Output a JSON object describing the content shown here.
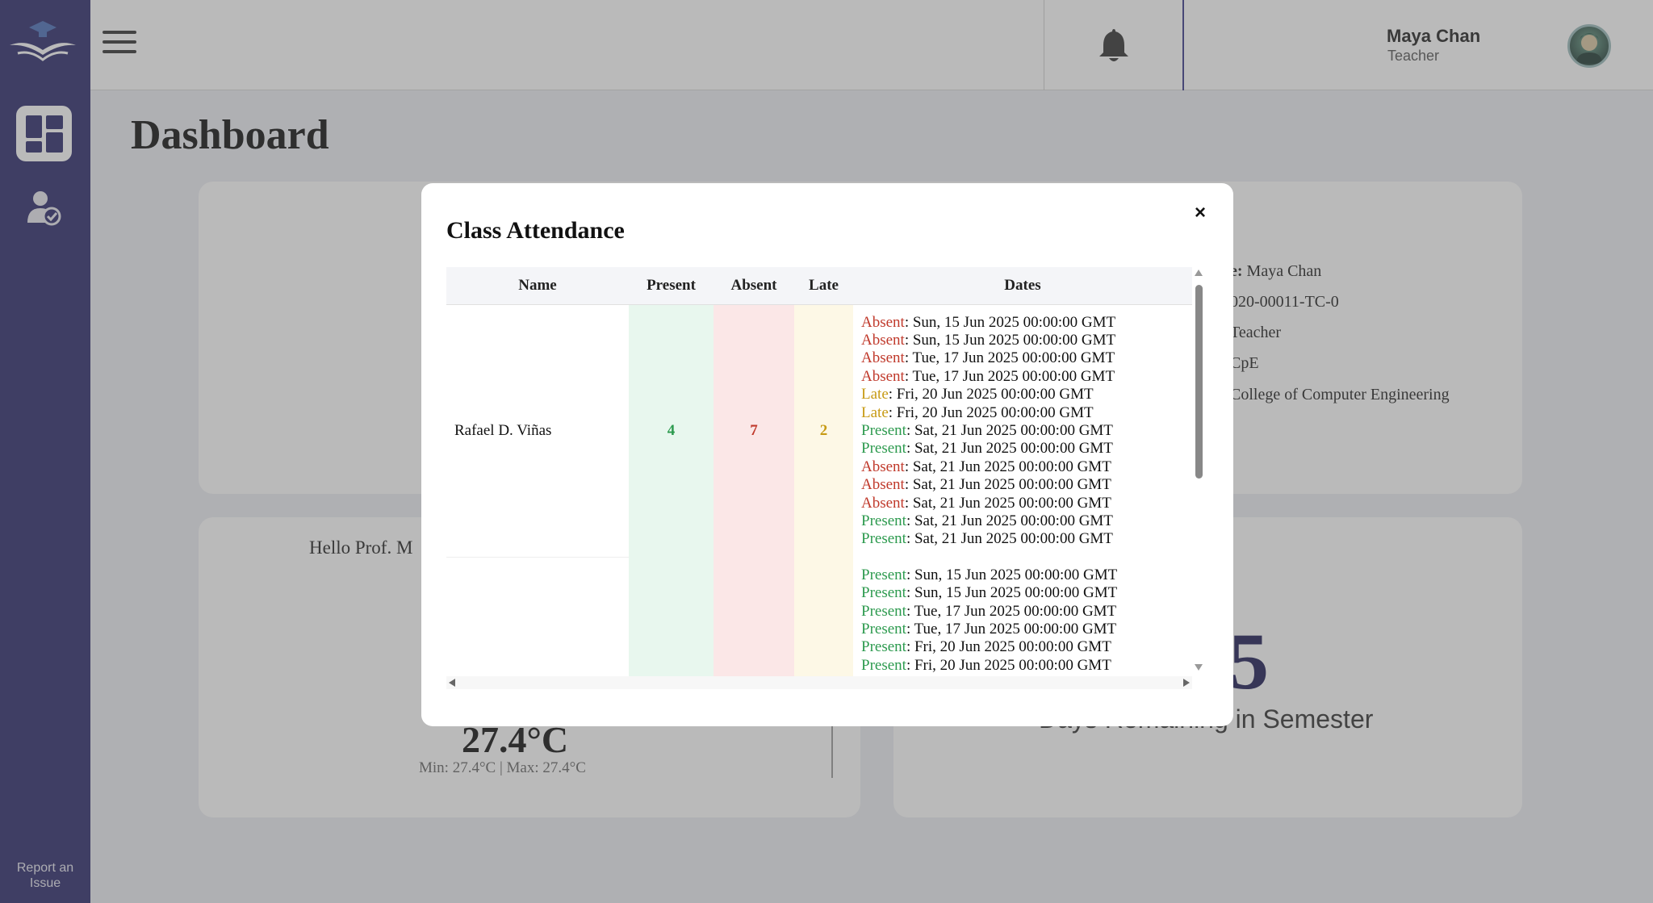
{
  "sidebar": {
    "report_label": "Report an Issue",
    "nav_icons": [
      "dashboard-icon",
      "attendance-icon"
    ],
    "colors": {
      "background": "#2b2a6b",
      "active": "#ffffff"
    }
  },
  "topbar": {
    "user_name": "Maya Chan",
    "user_role": "Teacher"
  },
  "page": {
    "title": "Dashboard"
  },
  "profile_card": {
    "name_line_label": "e:",
    "name_line_value": " Maya Chan",
    "id_line": "020-00011-TC-0",
    "role_line": " Teacher",
    "dept_line": "CpE",
    "college_line": "College of Computer Engineering"
  },
  "weather_card": {
    "greeting": "Hello Prof. M",
    "temperature": "27.4°C",
    "minmax": "Min: 27.4°C  |  Max: 27.4°C"
  },
  "days_card": {
    "value": "5",
    "label": "Days Remaining in Semester"
  },
  "modal": {
    "title": "Class Attendance",
    "close_label": "×",
    "columns": [
      "Name",
      "Present",
      "Absent",
      "Late",
      "Dates"
    ],
    "rows": [
      {
        "name": "Rafael D. Viñas",
        "present": "4",
        "absent": "7",
        "late": "2",
        "dates": [
          {
            "status": "Absent",
            "date": ": Sun, 15 Jun 2025 00:00:00 GMT"
          },
          {
            "status": "Absent",
            "date": ": Sun, 15 Jun 2025 00:00:00 GMT"
          },
          {
            "status": "Absent",
            "date": ": Tue, 17 Jun 2025 00:00:00 GMT"
          },
          {
            "status": "Absent",
            "date": ": Tue, 17 Jun 2025 00:00:00 GMT"
          },
          {
            "status": "Late",
            "date": ": Fri, 20 Jun 2025 00:00:00 GMT"
          },
          {
            "status": "Late",
            "date": ": Fri, 20 Jun 2025 00:00:00 GMT"
          },
          {
            "status": "Present",
            "date": ": Sat, 21 Jun 2025 00:00:00 GMT"
          },
          {
            "status": "Present",
            "date": ": Sat, 21 Jun 2025 00:00:00 GMT"
          },
          {
            "status": "Absent",
            "date": ": Sat, 21 Jun 2025 00:00:00 GMT"
          },
          {
            "status": "Absent",
            "date": ": Sat, 21 Jun 2025 00:00:00 GMT"
          },
          {
            "status": "Absent",
            "date": ": Sat, 21 Jun 2025 00:00:00 GMT"
          },
          {
            "status": "Present",
            "date": ": Sat, 21 Jun 2025 00:00:00 GMT"
          },
          {
            "status": "Present",
            "date": ": Sat, 21 Jun 2025 00:00:00 GMT"
          }
        ]
      },
      {
        "name": "",
        "present": "",
        "absent": "",
        "late": "",
        "dates": [
          {
            "status": "Present",
            "date": ": Sun, 15 Jun 2025 00:00:00 GMT"
          },
          {
            "status": "Present",
            "date": ": Sun, 15 Jun 2025 00:00:00 GMT"
          },
          {
            "status": "Present",
            "date": ": Tue, 17 Jun 2025 00:00:00 GMT"
          },
          {
            "status": "Present",
            "date": ": Tue, 17 Jun 2025 00:00:00 GMT"
          },
          {
            "status": "Present",
            "date": ": Fri, 20 Jun 2025 00:00:00 GMT"
          },
          {
            "status": "Present",
            "date": ": Fri, 20 Jun 2025 00:00:00 GMT"
          }
        ]
      }
    ],
    "status_colors": {
      "Absent": "#c0392b",
      "Late": "#c79a14",
      "Present": "#2c9a4e"
    }
  }
}
